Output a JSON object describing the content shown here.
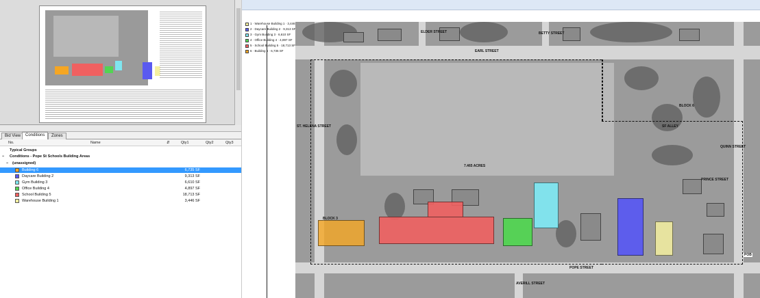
{
  "left_panel": {
    "tabs": [
      {
        "label": "Bid View"
      },
      {
        "label": "Conditions"
      },
      {
        "label": "Zones"
      }
    ],
    "grid": {
      "columns": [
        "No.",
        "Name",
        "Qty1",
        "Qty2",
        "Qty3"
      ],
      "groups": [
        {
          "label": "Typical Groups"
        },
        {
          "label": "Conditions - Pope St Schools Building Areas"
        },
        {
          "label": "(unassigned)"
        }
      ],
      "rows": [
        {
          "name": "Building 6",
          "qty1": "6,735 SF",
          "color": "#f5a623",
          "selected": true
        },
        {
          "name": "Daycare Building 2",
          "qty1": "9,313 SF",
          "color": "#5a5af0",
          "selected": false
        },
        {
          "name": "Gym Building 3",
          "qty1": "6,610 SF",
          "color": "#7fe6f0",
          "selected": false
        },
        {
          "name": "Office Building 4",
          "qty1": "4,897 SF",
          "color": "#52d452",
          "selected": false
        },
        {
          "name": "School Building 5",
          "qty1": "18,713 SF",
          "color": "#f06060",
          "selected": false
        },
        {
          "name": "Warehouse Building 1",
          "qty1": "3,446 SF",
          "color": "#f5f0a0",
          "selected": false
        }
      ]
    }
  },
  "viewer": {
    "legend": [
      {
        "text": "1 · Warehouse Building 1 · 3,446 SF",
        "color": "#f5f0a0"
      },
      {
        "text": "2 · Daycare Building 2 · 9,313 SF",
        "color": "#5a5af0"
      },
      {
        "text": "3 · Gym Building 3 · 6,610 SF",
        "color": "#7fe6f0"
      },
      {
        "text": "4 · Office Building 4 · 4,897 SF",
        "color": "#52d452"
      },
      {
        "text": "5 · School Building 5 · 18,713 SF",
        "color": "#f06060"
      },
      {
        "text": "6 · Building 6 · 6,735 SF",
        "color": "#f5a623"
      }
    ],
    "streets": {
      "elder": "ELDER STREET",
      "earl": "EARL STREET",
      "betty": "BETTY STREET",
      "pope": "POPE STREET",
      "averill": "AVERILL STREET",
      "st_helena": "ST. HELENA STREET",
      "quinn": "QUINN STREET",
      "prince": "PRINCE STREET",
      "sf_alley": "SF ALLEY"
    },
    "labels": {
      "pob": "POB",
      "acres": "7.465 ACRES",
      "block_3": "BLOCK 3",
      "block_6": "BLOCK 6"
    }
  }
}
